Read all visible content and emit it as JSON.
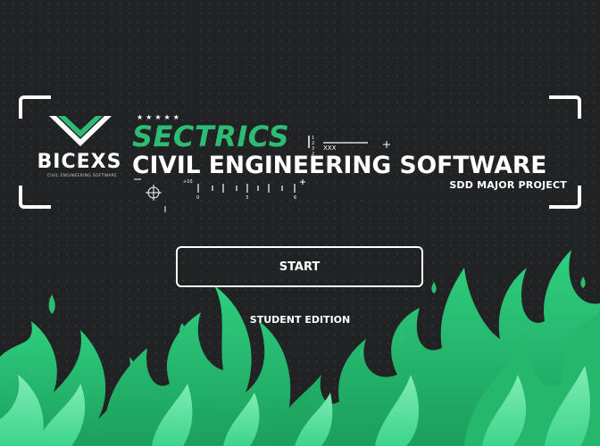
{
  "app": {
    "logo_text": "BICEXS",
    "logo_subtitle": "CIVIL ENGINEERING SOFTWARE",
    "stars": "★★★★★",
    "title_green": "SECTRICS",
    "title_main": "CIVIL ENGINEERING SOFTWARE",
    "title_sub": "SDD MAJOR PROJECT",
    "deco_label": "XXX",
    "deco_ruler_start": "+10",
    "deco_ruler_ticks": [
      "0",
      "3",
      "6"
    ],
    "deco_vertical": "12 32"
  },
  "menu": {
    "start_label": "START",
    "edition_label": "STUDENT EDITION"
  },
  "colors": {
    "background": "#212224",
    "accent_green": "#2dbd72",
    "flame_light": "#5ee3a2",
    "flame_dark": "#1f9e5c"
  }
}
